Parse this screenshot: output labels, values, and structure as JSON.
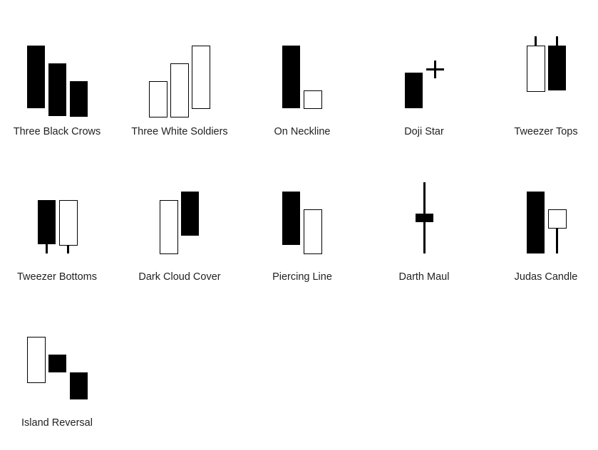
{
  "patterns": [
    {
      "name": "Three Black Crows"
    },
    {
      "name": "Three White Soldiers"
    },
    {
      "name": "On Neckline"
    },
    {
      "name": "Doji Star"
    },
    {
      "name": "Tweezer Tops"
    },
    {
      "name": "Tweezer Bottoms"
    },
    {
      "name": "Dark Cloud Cover"
    },
    {
      "name": "Piercing Line"
    },
    {
      "name": "Darth Maul"
    },
    {
      "name": "Judas Candle"
    },
    {
      "name": "Island Reversal"
    }
  ],
  "colors": {
    "bearish": "#000000",
    "bullish": "#ffffff",
    "outline": "#000000"
  }
}
